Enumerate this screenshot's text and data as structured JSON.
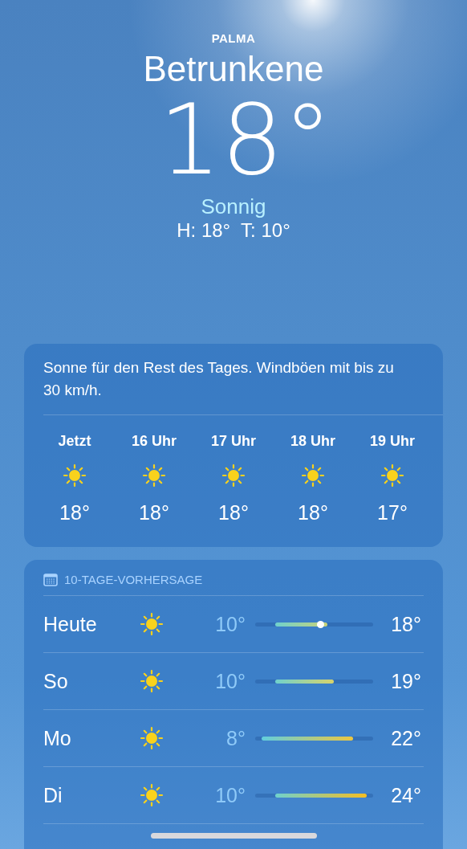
{
  "location": {
    "subtitle": "PALMA",
    "name": "Betrunkene",
    "temperature": "18°",
    "condition": "Sonnig",
    "high_low": "H: 18°  T: 10°"
  },
  "hourly_card": {
    "summary": "Sonne für den Rest des Tages. Windböen mit bis zu 30 km/h.",
    "hours": [
      {
        "time": "Jetzt",
        "temp": "18°"
      },
      {
        "time": "16 Uhr",
        "temp": "18°"
      },
      {
        "time": "17 Uhr",
        "temp": "18°"
      },
      {
        "time": "18 Uhr",
        "temp": "18°"
      },
      {
        "time": "19 Uhr",
        "temp": "17°"
      }
    ]
  },
  "forecast_card": {
    "title": "10-TAGE-VORHERSAGE",
    "days": [
      {
        "day": "Heute",
        "low": "10°",
        "high": "18°",
        "current": {
          "level": 0.55
        }
      },
      {
        "day": "So",
        "low": "10°",
        "high": "19°"
      },
      {
        "day": "Mo",
        "low": "8°",
        "high": "22°"
      },
      {
        "day": "Di",
        "low": "10°",
        "high": "24°"
      }
    ]
  }
}
